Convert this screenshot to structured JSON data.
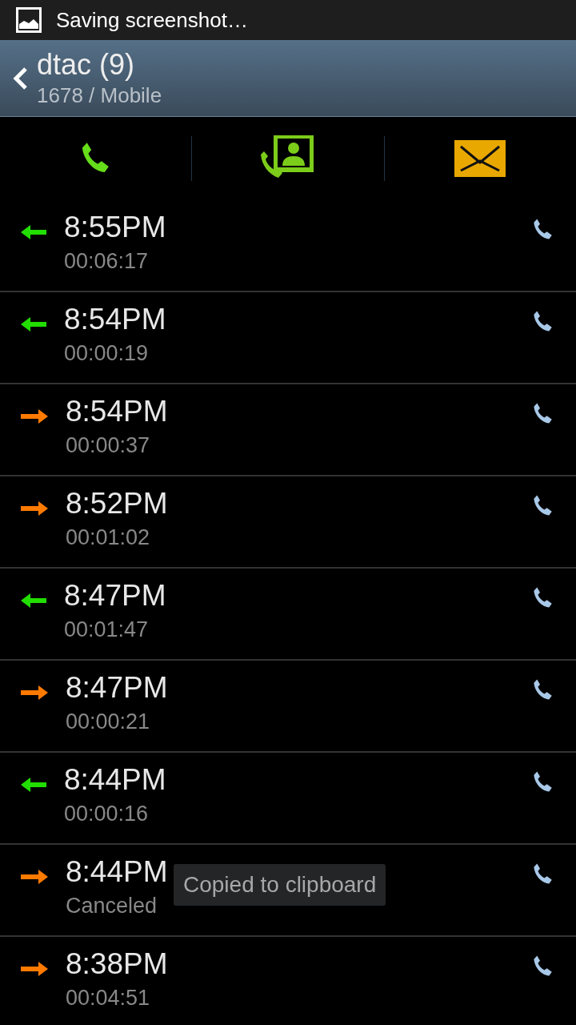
{
  "status_bar": {
    "notification": "Saving screenshot…"
  },
  "header": {
    "title": "dtac (9)",
    "subtitle": "1678 / Mobile"
  },
  "calls": [
    {
      "kind": "incoming",
      "time": "8:55PM",
      "detail": "00:06:17"
    },
    {
      "kind": "incoming",
      "time": "8:54PM",
      "detail": "00:00:19"
    },
    {
      "kind": "outgoing",
      "time": "8:54PM",
      "detail": "00:00:37"
    },
    {
      "kind": "outgoing",
      "time": "8:52PM",
      "detail": "00:01:02"
    },
    {
      "kind": "incoming",
      "time": "8:47PM",
      "detail": "00:01:47"
    },
    {
      "kind": "outgoing",
      "time": "8:47PM",
      "detail": "00:00:21"
    },
    {
      "kind": "incoming",
      "time": "8:44PM",
      "detail": "00:00:16"
    },
    {
      "kind": "outgoing",
      "time": "8:44PM",
      "detail": "Canceled"
    },
    {
      "kind": "outgoing",
      "time": "8:38PM",
      "detail": "00:04:51"
    }
  ],
  "toast": {
    "text": "Copied to clipboard"
  }
}
